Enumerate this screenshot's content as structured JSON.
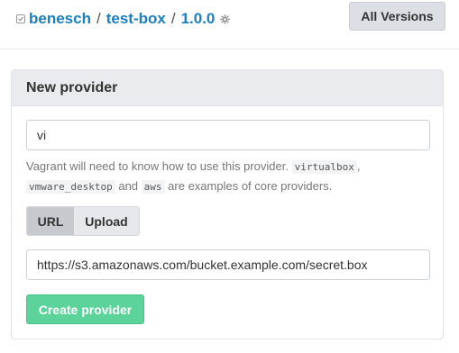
{
  "breadcrumb": {
    "owner": "benesch",
    "separator": "/",
    "box": "test-box",
    "version": "1.0.0"
  },
  "header": {
    "all_versions_label": "All Versions"
  },
  "panel": {
    "title": "New provider",
    "provider_name_value": "vi",
    "help": {
      "text_1": "Vagrant will need to know how to use this provider.",
      "code_1": "virtualbox",
      "text_2": ",",
      "code_2": "vmware_desktop",
      "text_3": "and",
      "code_3": "aws",
      "text_4": "are examples of core providers."
    },
    "tabs": {
      "url_label": "URL",
      "upload_label": "Upload",
      "active": "URL"
    },
    "url_value": "https://s3.amazonaws.com/bucket.example.com/secret.box",
    "create_label": "Create provider"
  },
  "colors": {
    "link": "#1a7fbf",
    "create_button": "#5bd39a",
    "panel_header": "#e9ebee"
  },
  "icons": {
    "verified": "check-icon",
    "settings": "cog-icon"
  }
}
